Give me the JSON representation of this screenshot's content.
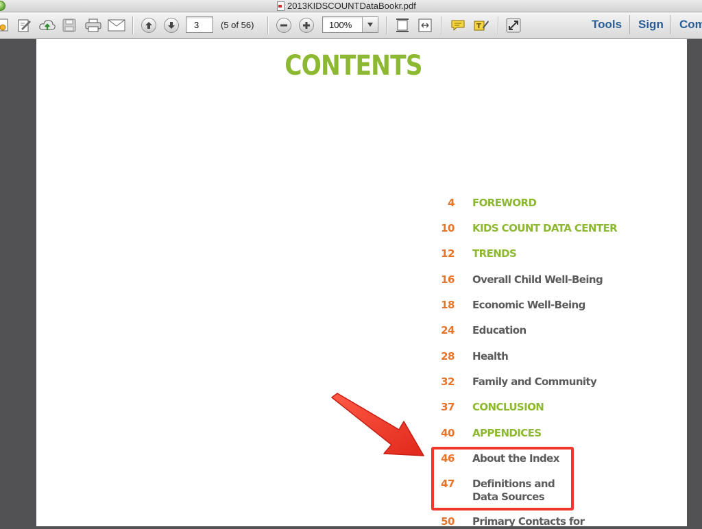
{
  "window": {
    "title": "2013KIDSCOUNTDataBookr.pdf"
  },
  "toolbar": {
    "icons": [
      "create-pdf-icon",
      "edit-icon",
      "upload-icon",
      "save-icon",
      "print-icon",
      "email-icon",
      "previous-page-icon",
      "next-page-icon",
      "zoom-out-icon",
      "zoom-in-icon",
      "fit-page-icon",
      "fit-width-icon",
      "comment-icon",
      "highlight-icon",
      "fullscreen-icon"
    ],
    "page_number": "3",
    "page_count": "(5 of 56)",
    "zoom": "100%",
    "tools_label": "Tools",
    "sign_label": "Sign",
    "comment_label": "Com"
  },
  "document": {
    "heading": "CONTENTS",
    "toc": [
      {
        "page": "4",
        "title": "FOREWORD",
        "kind": "section"
      },
      {
        "page": "10",
        "title": "KIDS COUNT DATA CENTER",
        "kind": "section"
      },
      {
        "page": "12",
        "title": "TRENDS",
        "kind": "section"
      },
      {
        "page": "16",
        "title": "Overall Child Well-Being",
        "kind": "sub"
      },
      {
        "page": "18",
        "title": "Economic Well-Being",
        "kind": "sub"
      },
      {
        "page": "24",
        "title": "Education",
        "kind": "sub"
      },
      {
        "page": "28",
        "title": "Health",
        "kind": "sub"
      },
      {
        "page": "32",
        "title": "Family and Community",
        "kind": "sub"
      },
      {
        "page": "37",
        "title": "CONCLUSION",
        "kind": "section"
      },
      {
        "page": "40",
        "title": "APPENDICES",
        "kind": "section"
      },
      {
        "page": "46",
        "title": "About the Index",
        "kind": "sub"
      },
      {
        "page": "47",
        "title": "Definitions and",
        "title2": "Data Sources",
        "kind": "sub"
      },
      {
        "page": "50",
        "title": "Primary Contacts for",
        "kind": "sub"
      }
    ]
  },
  "colors": {
    "section_green": "#8db832",
    "page_orange": "#e8742a",
    "sub_gray": "#5b5b5b",
    "annotation_red": "#f0372a",
    "link_blue": "#2a5d95"
  }
}
